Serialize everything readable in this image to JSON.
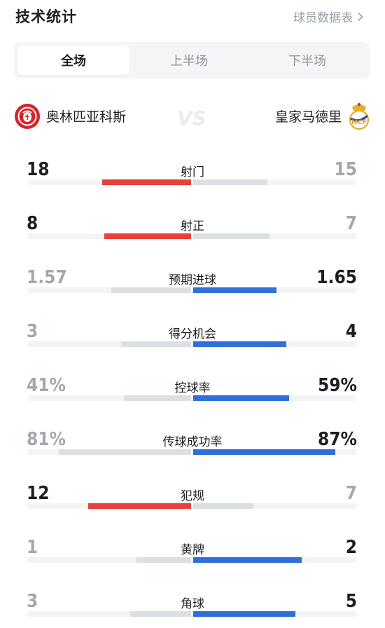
{
  "header": {
    "title": "技术统计",
    "link_label": "球员数据表"
  },
  "tabs": [
    {
      "label": "全场",
      "active": true
    },
    {
      "label": "上半场",
      "active": false
    },
    {
      "label": "下半场",
      "active": false
    }
  ],
  "teams": {
    "home": {
      "name": "奥林匹亚科斯",
      "crest": "olympiacos-crest-icon"
    },
    "vs": "VS",
    "away": {
      "name": "皇家马德里",
      "crest": "real-madrid-crest-icon"
    }
  },
  "colors": {
    "home_win": "#e8403b",
    "away_win": "#2f6fdb",
    "lose": "#dcdfe3",
    "track": "#f3f4f6"
  },
  "stats": [
    {
      "label": "射门",
      "home": "18",
      "away": "15",
      "home_value": 18,
      "away_value": 15
    },
    {
      "label": "射正",
      "home": "8",
      "away": "7",
      "home_value": 8,
      "away_value": 7
    },
    {
      "label": "预期进球",
      "home": "1.57",
      "away": "1.65",
      "home_value": 1.57,
      "away_value": 1.65
    },
    {
      "label": "得分机会",
      "home": "3",
      "away": "4",
      "home_value": 3,
      "away_value": 4
    },
    {
      "label": "控球率",
      "home": "41%",
      "away": "59%",
      "home_value": 41,
      "away_value": 59
    },
    {
      "label": "传球成功率",
      "home": "81%",
      "away": "87%",
      "home_value": 81,
      "away_value": 87
    },
    {
      "label": "犯规",
      "home": "12",
      "away": "7",
      "home_value": 12,
      "away_value": 7
    },
    {
      "label": "黄牌",
      "home": "1",
      "away": "2",
      "home_value": 1,
      "away_value": 2
    },
    {
      "label": "角球",
      "home": "3",
      "away": "5",
      "home_value": 3,
      "away_value": 5
    }
  ]
}
